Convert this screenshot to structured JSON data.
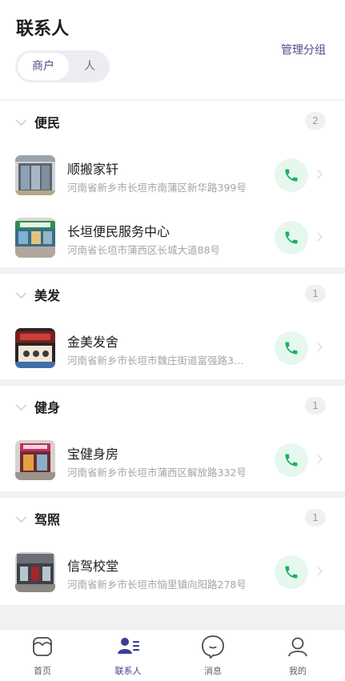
{
  "header": {
    "title": "联系人",
    "manage_label": "管理分组",
    "segments": {
      "merchant": "商户",
      "person": "人"
    }
  },
  "sections": [
    {
      "title": "便民",
      "count": "2",
      "items": [
        {
          "name": "顺搬家轩",
          "address": "河南省新乡市长垣市南蒲区新华路399号",
          "thumb": "shop-door-photo"
        },
        {
          "name": "长垣便民服务中心",
          "address": "河南省长垣市蒲西区长城大道88号",
          "thumb": "supermarket-photo"
        }
      ]
    },
    {
      "title": "美发",
      "count": "1",
      "items": [
        {
          "name": "金美发舍",
          "address": "河南省新乡市长垣市魏庄街道富强路3…",
          "thumb": "salon-photo"
        }
      ]
    },
    {
      "title": "健身",
      "count": "1",
      "items": [
        {
          "name": "宝健身房",
          "address": "河南省新乡市长垣市蒲西区解放路332号",
          "thumb": "gym-photo"
        }
      ]
    },
    {
      "title": "驾照",
      "count": "1",
      "items": [
        {
          "name": "信驾校堂",
          "address": "河南省新乡市长垣市恼里镇向阳路278号",
          "thumb": "driving-school-photo"
        }
      ]
    }
  ],
  "tabbar": {
    "items": [
      {
        "label": "首页",
        "icon": "home-icon"
      },
      {
        "label": "联系人",
        "icon": "contacts-icon"
      },
      {
        "label": "消息",
        "icon": "message-icon"
      },
      {
        "label": "我的",
        "icon": "profile-icon"
      }
    ]
  },
  "colors": {
    "accent": "#4a4d8c",
    "call_green": "#16b45b",
    "call_bg": "#e6f7ee"
  }
}
